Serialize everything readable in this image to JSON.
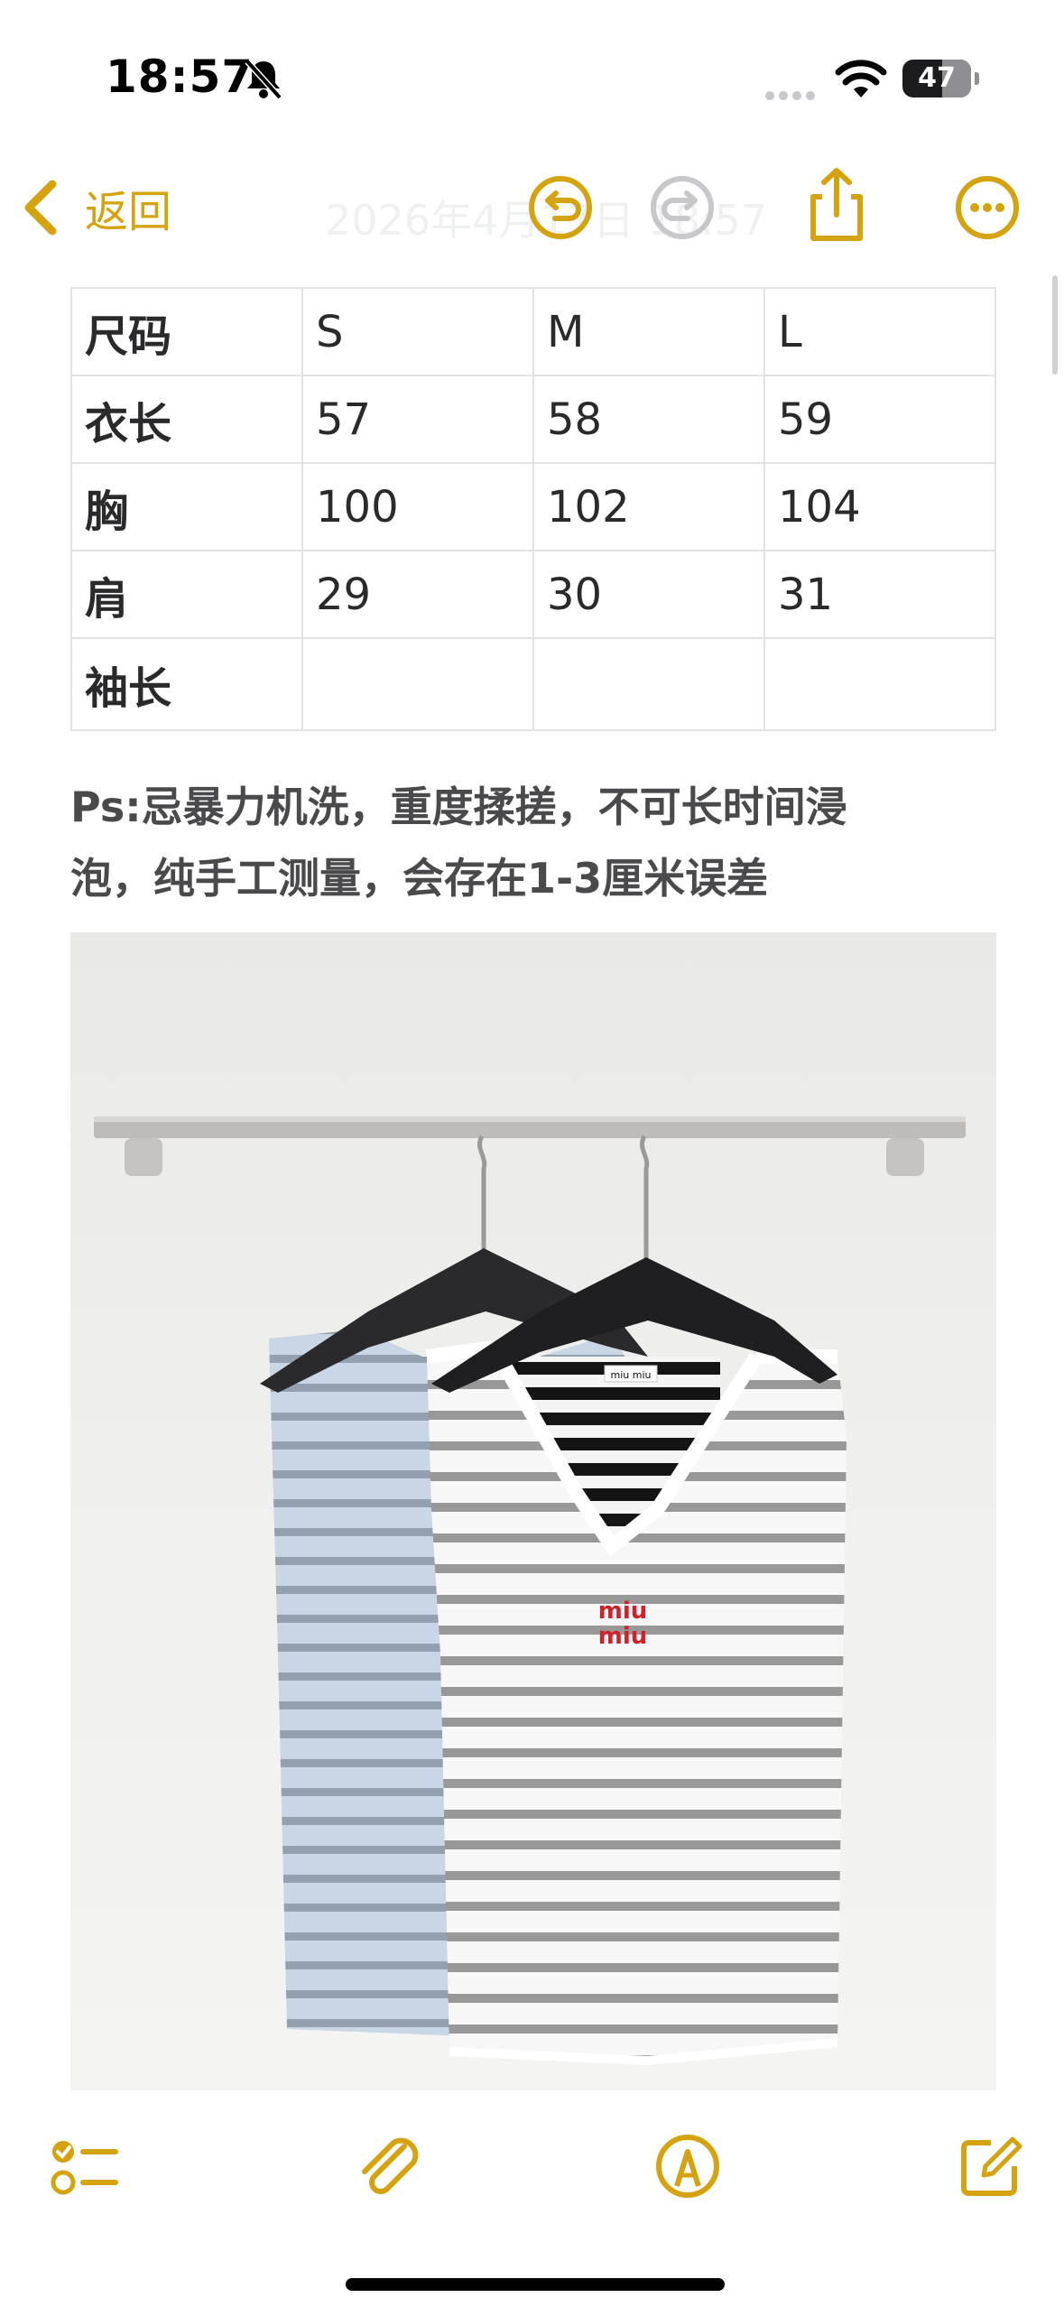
{
  "status_bar": {
    "time": "18:57",
    "battery": "47"
  },
  "nav": {
    "back_label": "返回",
    "faded_title": "2026年4月17日 18:57"
  },
  "table": {
    "rows": [
      [
        "尺码",
        "S",
        "M",
        "L"
      ],
      [
        "衣长",
        "57",
        "58",
        "59"
      ],
      [
        "胸",
        "100",
        "102",
        "104"
      ],
      [
        "肩",
        "29",
        "30",
        "31"
      ],
      [
        "袖长",
        "",
        "",
        ""
      ]
    ]
  },
  "note": {
    "line1": "Ps:忌暴力机洗，重度揉搓，不可长时间浸",
    "line2": "泡，纯手工测量，会存在1-3厘米误差"
  },
  "photo": {
    "label_text": "miu miu",
    "logo_line1": "miu",
    "logo_line2": "miu"
  },
  "colors": {
    "accent": "#d4a30f",
    "text": "#1c1c1e"
  },
  "icons": {
    "nav": [
      "chevron-left-icon",
      "undo-icon",
      "redo-icon",
      "share-icon",
      "more-icon"
    ],
    "toolbar": [
      "checklist-icon",
      "paperclip-icon",
      "markup-pen-icon",
      "compose-icon"
    ]
  }
}
